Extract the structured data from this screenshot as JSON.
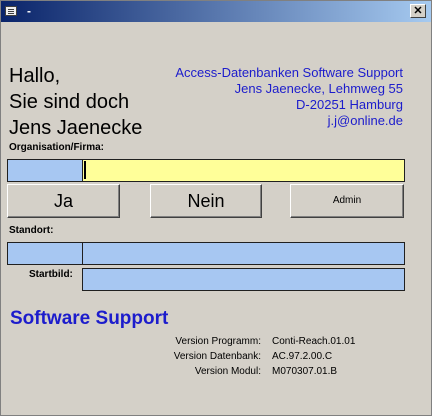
{
  "window": {
    "title": "-",
    "close_glyph": "✕"
  },
  "greeting": {
    "line1": "Hallo,",
    "line2": "Sie sind doch",
    "line3": "Jens Jaenecke"
  },
  "address": {
    "line1": "Access-Datenbanken Software Support",
    "line2": "Jens Jaenecke, Lehmweg 55",
    "line3": "D-20251 Hamburg",
    "line4": "j.j@online.de"
  },
  "form": {
    "org_label": "Organisation/Firma:",
    "org_code": "",
    "org_name": "",
    "standort_label": "Standort:",
    "standort_code": "",
    "standort_name": "",
    "startbild_label": "Startbild:",
    "startbild_value": ""
  },
  "buttons": {
    "ja": "Ja",
    "nein": "Nein",
    "admin": "Admin"
  },
  "support": {
    "title": "Software Support"
  },
  "versions": [
    {
      "label": "Version Programm:",
      "value": "Conti-Reach.01.01"
    },
    {
      "label": "Version Datenbank:",
      "value": "AC.97.2.00.C"
    },
    {
      "label": "Version Modul:",
      "value": "M070307.01.B"
    }
  ],
  "colors": {
    "accent_blue_text": "#1c1ccc",
    "field_blue": "#a7c7f2",
    "field_yellow": "#ffff99",
    "titlebar_start": "#0a246a",
    "titlebar_end": "#a6caf0"
  }
}
